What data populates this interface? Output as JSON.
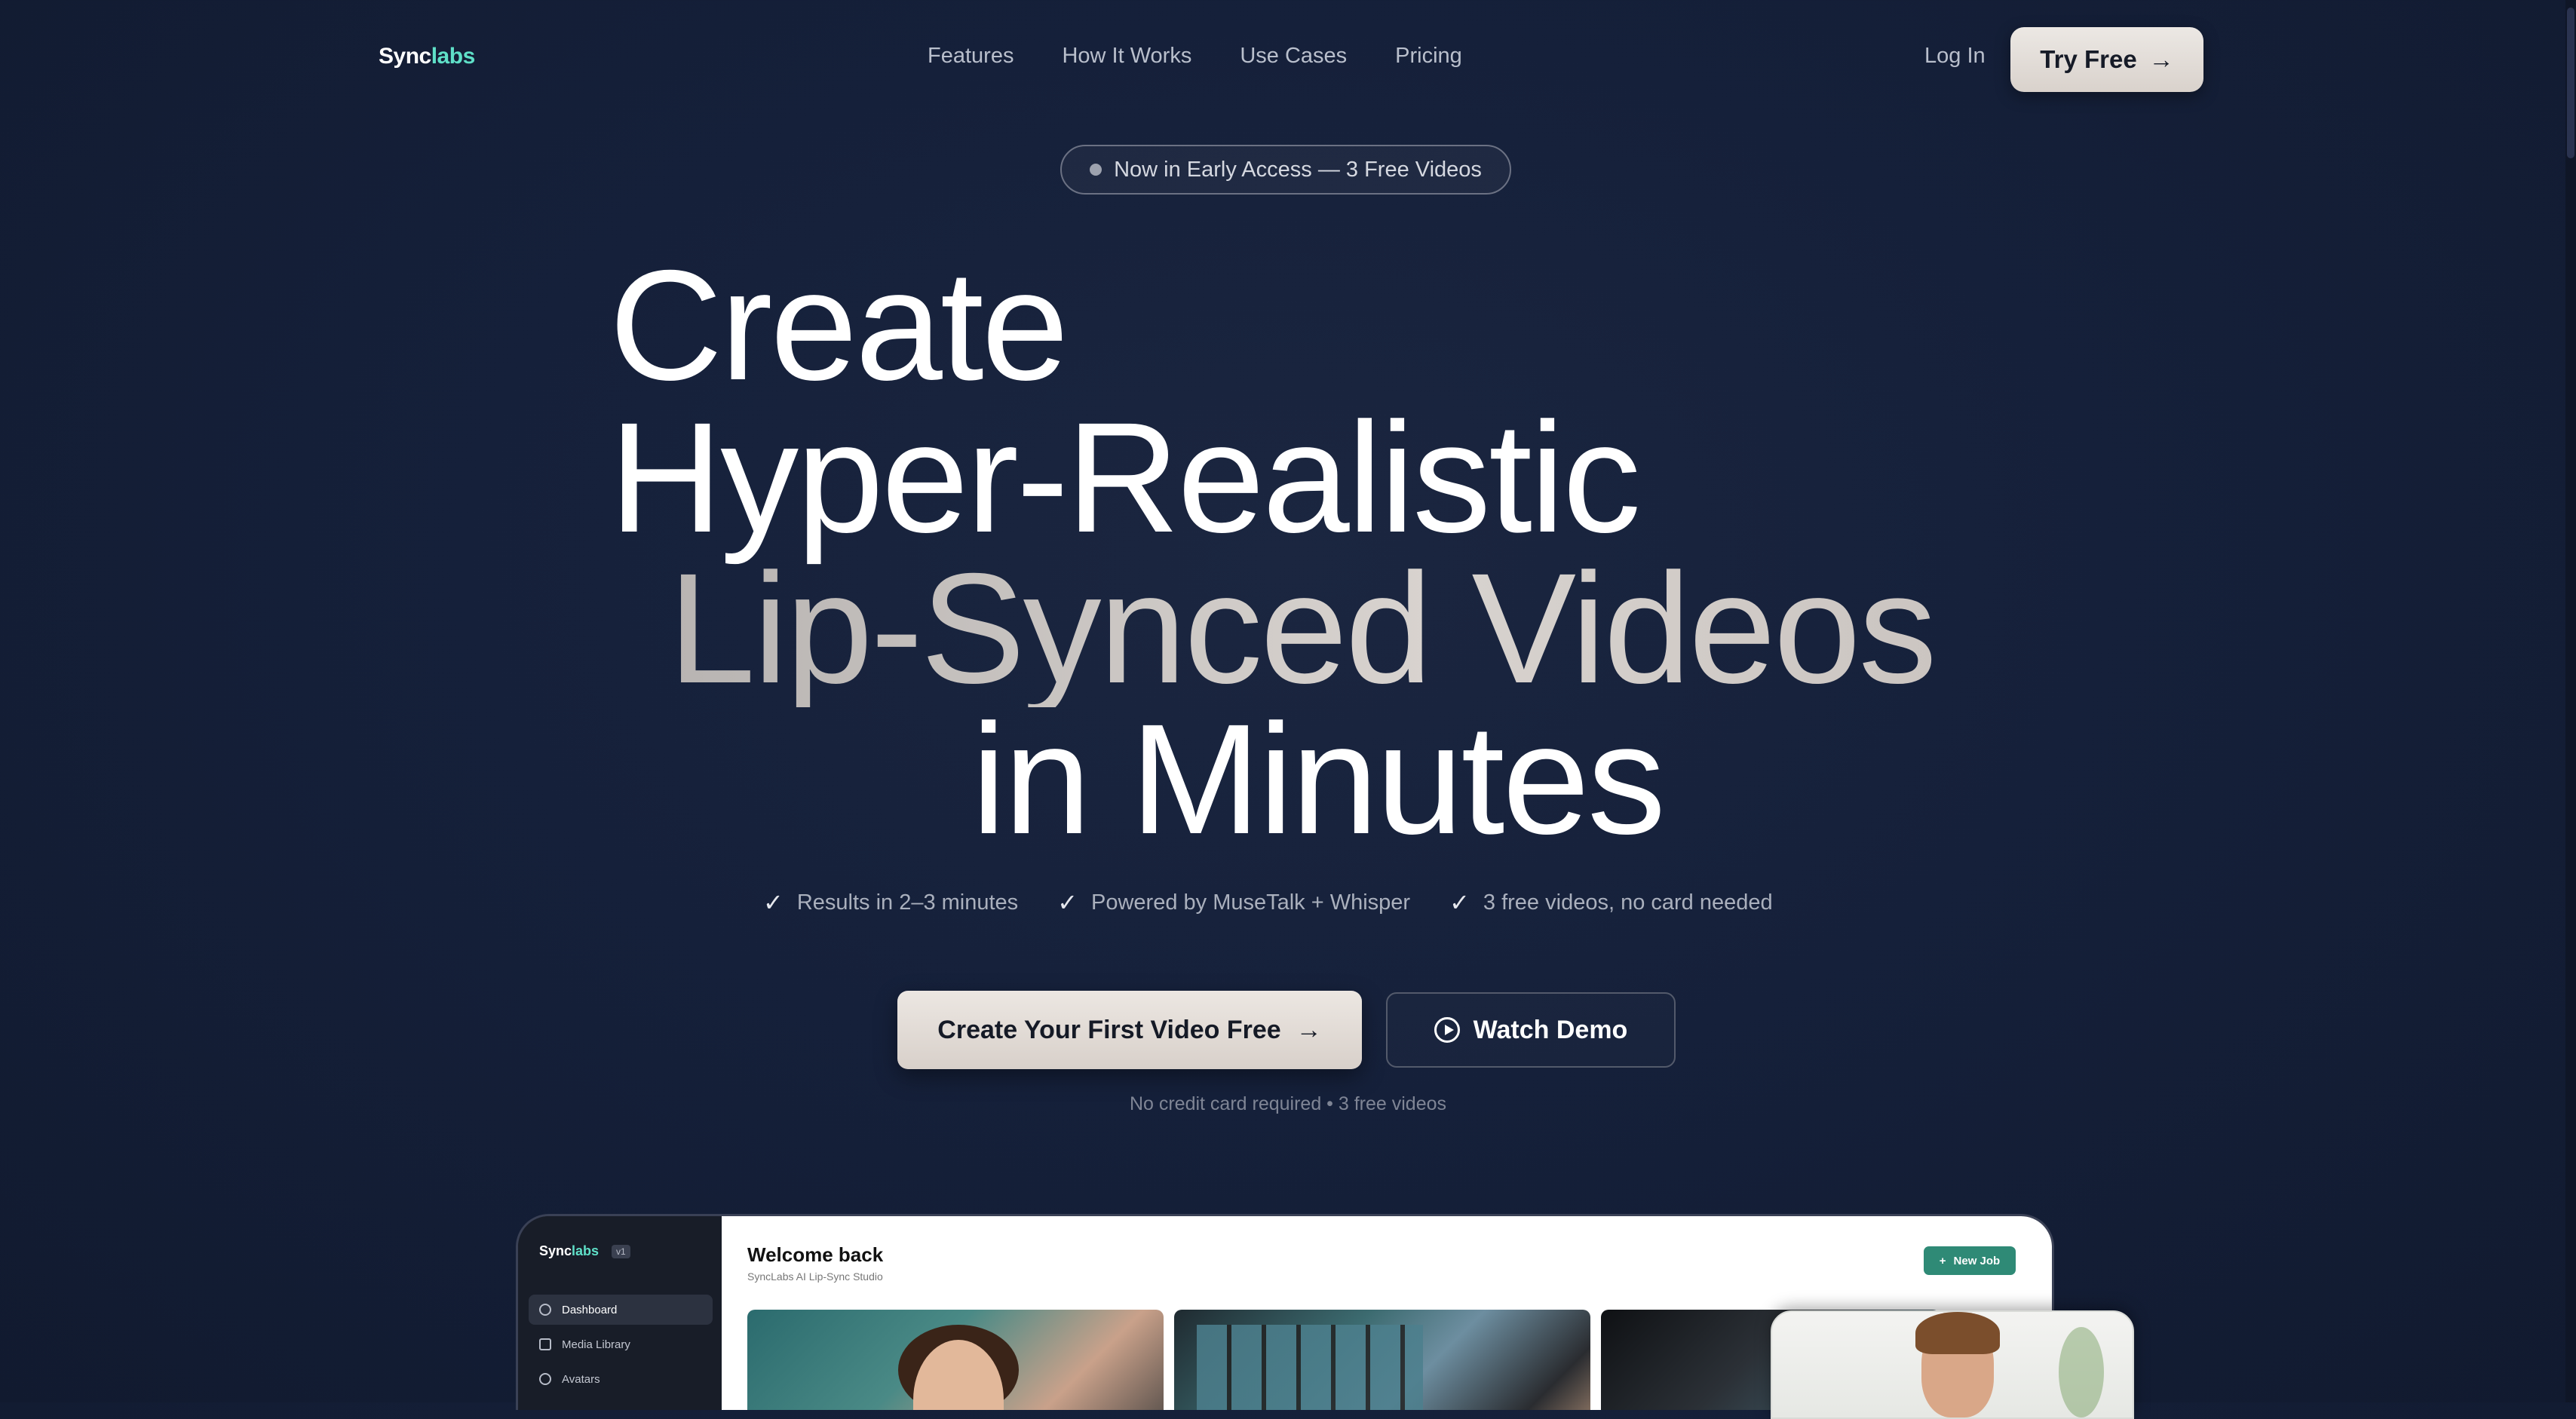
{
  "brand": {
    "name_part1": "Sync",
    "name_part2": "labs",
    "accent_color": "#5fe0c8"
  },
  "nav": {
    "links": [
      "Features",
      "How It Works",
      "Use Cases",
      "Pricing"
    ],
    "login": "Log In",
    "try_free": "Try Free",
    "arrow": "→"
  },
  "badge": {
    "text": "Now in Early Access — 3 Free Videos"
  },
  "hero": {
    "line1": "Create",
    "line2": "Hyper-Realistic",
    "line3": "Lip-Synced Videos",
    "line4": "in Minutes"
  },
  "checks": [
    "Results in 2–3 minutes",
    "Powered by MuseTalk + Whisper",
    "3 free videos, no card needed"
  ],
  "check_glyph": "✓",
  "cta": {
    "primary": "Create Your First Video Free",
    "secondary": "Watch Demo",
    "note": "No credit card required • 3 free videos"
  },
  "app_preview": {
    "logo_part1": "Sync",
    "logo_part2": "labs",
    "version": "v1",
    "sidebar": [
      "Dashboard",
      "Media Library",
      "Avatars"
    ],
    "title": "Welcome back",
    "subtitle": "SyncLabs AI Lip-Sync Studio",
    "new_job": "New Job",
    "plus": "+",
    "primary_color": "#2f8a76"
  }
}
